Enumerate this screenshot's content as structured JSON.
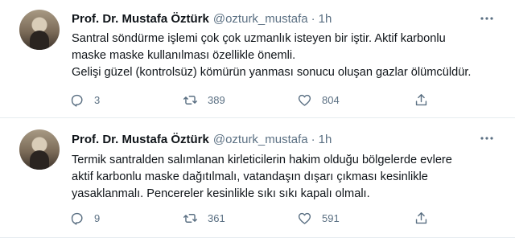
{
  "tweets": [
    {
      "author_name": "Prof. Dr. Mustafa Öztürk",
      "handle": "@ozturk_mustafa",
      "separator": "·",
      "time": "1h",
      "lines": [
        "Santral söndürme işlemi çok çok uzmanlık isteyen bir iştir. Aktif karbonlu",
        "maske maske kullanılması özellikle önemli.",
        "Gelişi güzel (kontrolsüz) kömürün yanması sonucu oluşan gazlar ölümcüldür."
      ],
      "replies": "3",
      "retweets": "389",
      "likes": "804"
    },
    {
      "author_name": "Prof. Dr. Mustafa Öztürk",
      "handle": "@ozturk_mustafa",
      "separator": "·",
      "time": "1h",
      "lines": [
        "Termik santralden salımlanan kirleticilerin hakim olduğu bölgelerde evlere",
        "aktif karbonlu maske dağıtılmalı, vatandaşın dışarı çıkması kesinlikle",
        "yasaklanmalı. Pencereler kesinlikle sıkı sıkı kapalı olmalı."
      ],
      "replies": "9",
      "retweets": "361",
      "likes": "591"
    }
  ],
  "icons": {
    "reply": "reply-icon",
    "retweet": "retweet-icon",
    "like": "heart-icon",
    "share": "share-icon",
    "more": "more-icon"
  },
  "colors": {
    "text": "#0f1419",
    "secondary": "#5b7083",
    "divider": "#e6ecf0"
  }
}
